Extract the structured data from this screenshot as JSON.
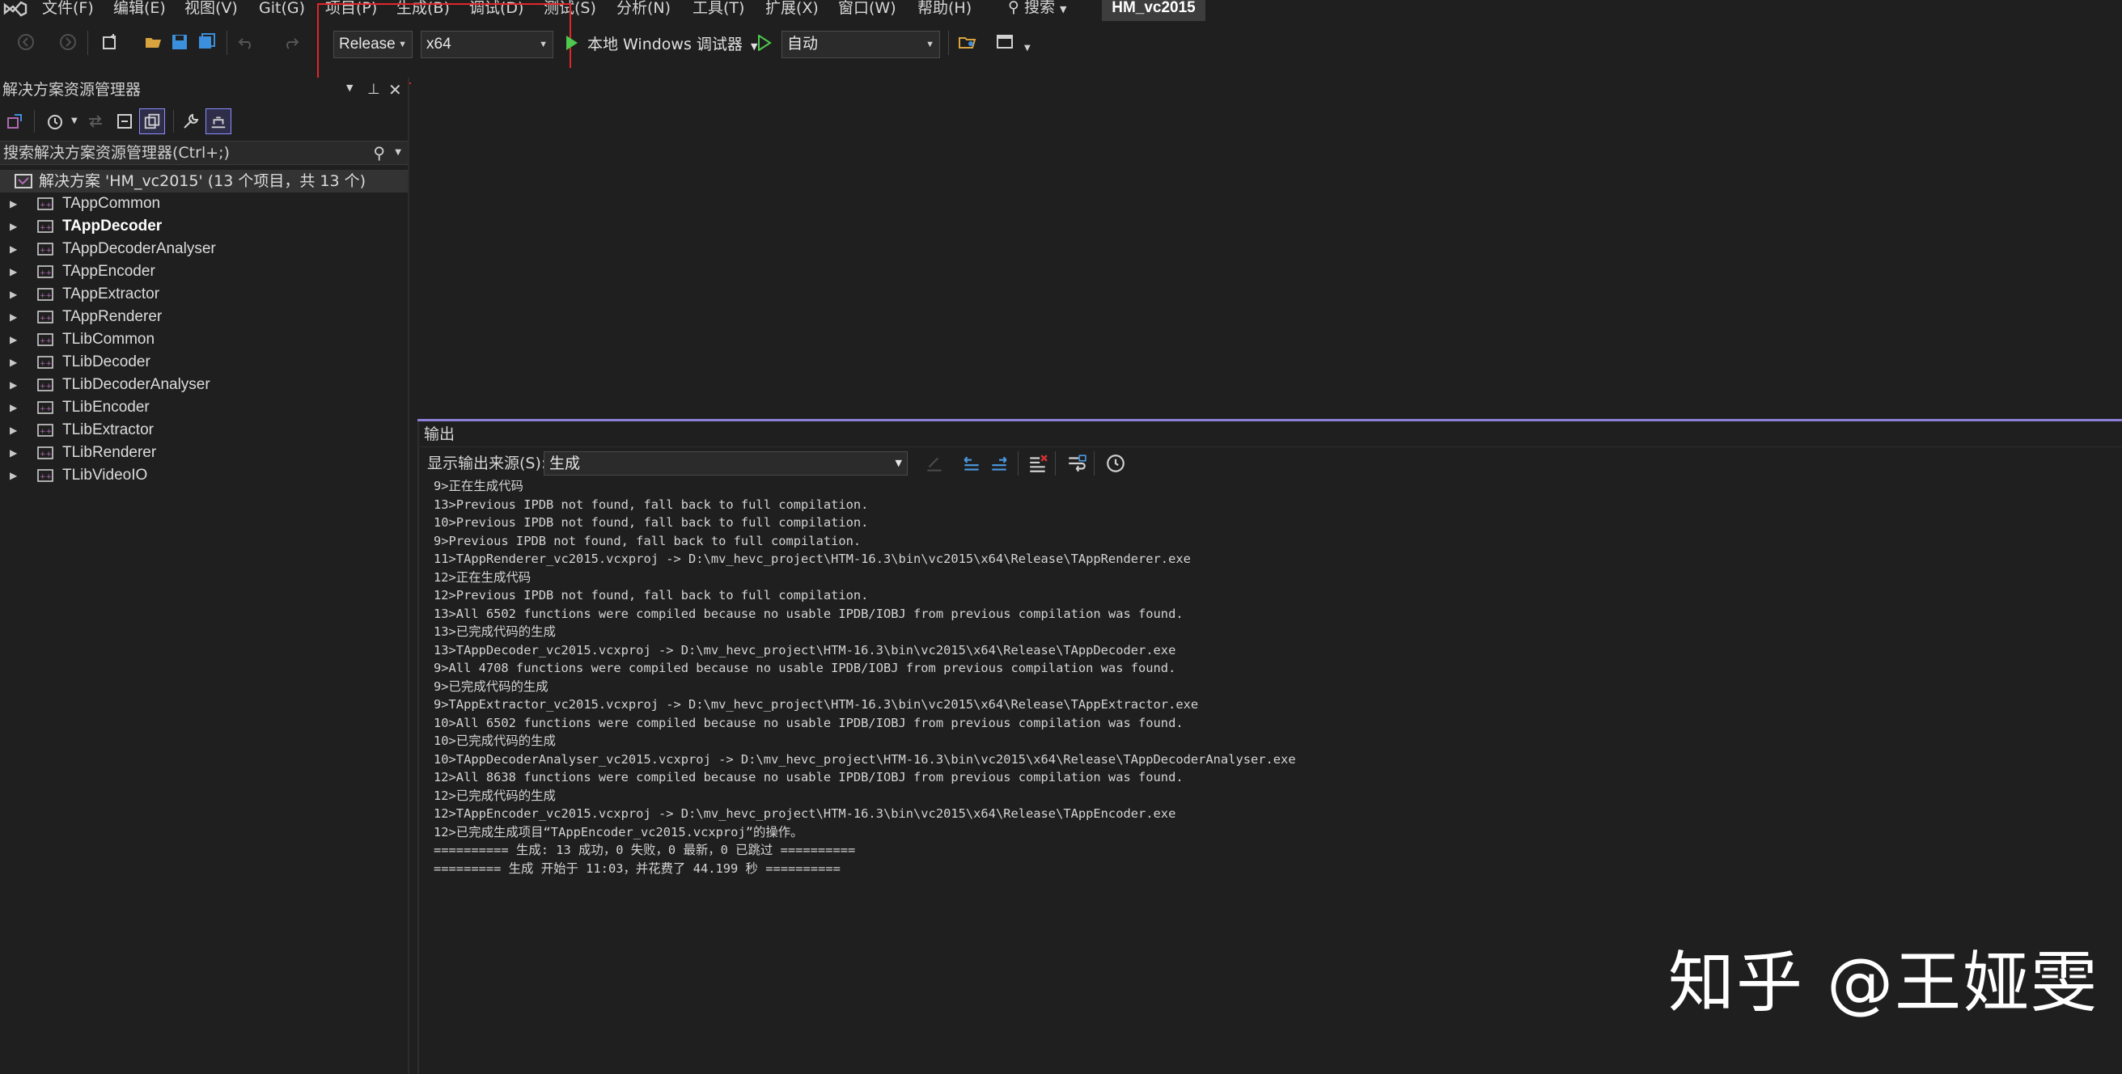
{
  "menu": {
    "items": [
      "文件(F)",
      "编辑(E)",
      "视图(V)",
      "Git(G)",
      "项目(P)",
      "生成(B)",
      "调试(D)",
      "测试(S)",
      "分析(N)",
      "工具(T)",
      "扩展(X)",
      "窗口(W)",
      "帮助(H)"
    ],
    "search_label": "搜索",
    "solution_name": "HM_vc2015"
  },
  "toolbar": {
    "configuration": "Release",
    "platform": "x64",
    "debugger": "本地 Windows 调试器",
    "mode": "自动"
  },
  "solution_explorer": {
    "title": "解决方案资源管理器",
    "search_placeholder": "搜索解决方案资源管理器(Ctrl+;)",
    "solution_label": "解决方案 'HM_vc2015' (13 个项目，共 13 个)",
    "projects": [
      {
        "name": "TAppCommon",
        "bold": false
      },
      {
        "name": "TAppDecoder",
        "bold": true
      },
      {
        "name": "TAppDecoderAnalyser",
        "bold": false
      },
      {
        "name": "TAppEncoder",
        "bold": false
      },
      {
        "name": "TAppExtractor",
        "bold": false
      },
      {
        "name": "TAppRenderer",
        "bold": false
      },
      {
        "name": "TLibCommon",
        "bold": false
      },
      {
        "name": "TLibDecoder",
        "bold": false
      },
      {
        "name": "TLibDecoderAnalyser",
        "bold": false
      },
      {
        "name": "TLibEncoder",
        "bold": false
      },
      {
        "name": "TLibExtractor",
        "bold": false
      },
      {
        "name": "TLibRenderer",
        "bold": false
      },
      {
        "name": "TLibVideoIO",
        "bold": false
      }
    ]
  },
  "output": {
    "title": "输出",
    "source_label": "显示输出来源(S):",
    "source_value": "生成",
    "lines": [
      "9>正在生成代码",
      "13>Previous IPDB not found, fall back to full compilation.",
      "10>Previous IPDB not found, fall back to full compilation.",
      "9>Previous IPDB not found, fall back to full compilation.",
      "11>TAppRenderer_vc2015.vcxproj -> D:\\mv_hevc_project\\HTM-16.3\\bin\\vc2015\\x64\\Release\\TAppRenderer.exe",
      "12>正在生成代码",
      "12>Previous IPDB not found, fall back to full compilation.",
      "13>All 6502 functions were compiled because no usable IPDB/IOBJ from previous compilation was found.",
      "13>已完成代码的生成",
      "13>TAppDecoder_vc2015.vcxproj -> D:\\mv_hevc_project\\HTM-16.3\\bin\\vc2015\\x64\\Release\\TAppDecoder.exe",
      "9>All 4708 functions were compiled because no usable IPDB/IOBJ from previous compilation was found.",
      "9>已完成代码的生成",
      "9>TAppExtractor_vc2015.vcxproj -> D:\\mv_hevc_project\\HTM-16.3\\bin\\vc2015\\x64\\Release\\TAppExtractor.exe",
      "10>All 6502 functions were compiled because no usable IPDB/IOBJ from previous compilation was found.",
      "10>已完成代码的生成",
      "10>TAppDecoderAnalyser_vc2015.vcxproj -> D:\\mv_hevc_project\\HTM-16.3\\bin\\vc2015\\x64\\Release\\TAppDecoderAnalyser.exe",
      "12>All 8638 functions were compiled because no usable IPDB/IOBJ from previous compilation was found.",
      "12>已完成代码的生成",
      "12>TAppEncoder_vc2015.vcxproj -> D:\\mv_hevc_project\\HTM-16.3\\bin\\vc2015\\x64\\Release\\TAppEncoder.exe",
      "12>已完成生成项目“TAppEncoder_vc2015.vcxproj”的操作。",
      "========== 生成: 13 成功，0 失败，0 最新，0 已跳过 ==========",
      "========= 生成 开始于 11:03，并花费了 44.199 秒 =========="
    ]
  },
  "watermark": "知乎 @王娅雯",
  "colors": {
    "background": "#1f1f1f",
    "highlight_box": "#e0262b",
    "output_accent": "#8b7fd6",
    "project_icon": "#b06ab3",
    "run_green": "#4ec94e"
  }
}
